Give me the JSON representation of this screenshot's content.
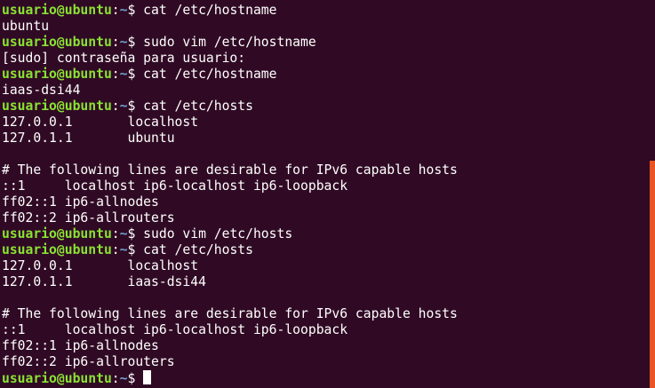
{
  "terminal": {
    "prompt_user": "usuario@ubuntu",
    "prompt_path": "~",
    "prompt_symbol": "$",
    "scroll_position": 0.42,
    "lines": [
      {
        "type": "cmd",
        "text": " cat /etc/hostname"
      },
      {
        "type": "out",
        "text": "ubuntu"
      },
      {
        "type": "cmd",
        "text": " sudo vim /etc/hostname"
      },
      {
        "type": "out",
        "text": "[sudo] contraseña para usuario:"
      },
      {
        "type": "cmd",
        "text": " cat /etc/hostname"
      },
      {
        "type": "out",
        "text": "iaas-dsi44"
      },
      {
        "type": "cmd",
        "text": " cat /etc/hosts"
      },
      {
        "type": "out",
        "text": "127.0.0.1       localhost"
      },
      {
        "type": "out",
        "text": "127.0.1.1       ubuntu"
      },
      {
        "type": "out",
        "text": ""
      },
      {
        "type": "out",
        "text": "# The following lines are desirable for IPv6 capable hosts"
      },
      {
        "type": "out",
        "text": "::1     localhost ip6-localhost ip6-loopback"
      },
      {
        "type": "out",
        "text": "ff02::1 ip6-allnodes"
      },
      {
        "type": "out",
        "text": "ff02::2 ip6-allrouters"
      },
      {
        "type": "cmd",
        "text": " sudo vim /etc/hosts"
      },
      {
        "type": "cmd",
        "text": " cat /etc/hosts"
      },
      {
        "type": "out",
        "text": "127.0.0.1       localhost"
      },
      {
        "type": "out",
        "text": "127.0.1.1       iaas-dsi44"
      },
      {
        "type": "out",
        "text": ""
      },
      {
        "type": "out",
        "text": "# The following lines are desirable for IPv6 capable hosts"
      },
      {
        "type": "out",
        "text": "::1     localhost ip6-localhost ip6-loopback"
      },
      {
        "type": "out",
        "text": "ff02::1 ip6-allnodes"
      },
      {
        "type": "out",
        "text": "ff02::2 ip6-allrouters"
      },
      {
        "type": "prompt",
        "text": " "
      }
    ]
  },
  "colors": {
    "background": "#300a24",
    "user": "#8ae234",
    "path": "#729fcf",
    "text": "#ffffff",
    "scrollbar_thumb": "#e95420"
  }
}
